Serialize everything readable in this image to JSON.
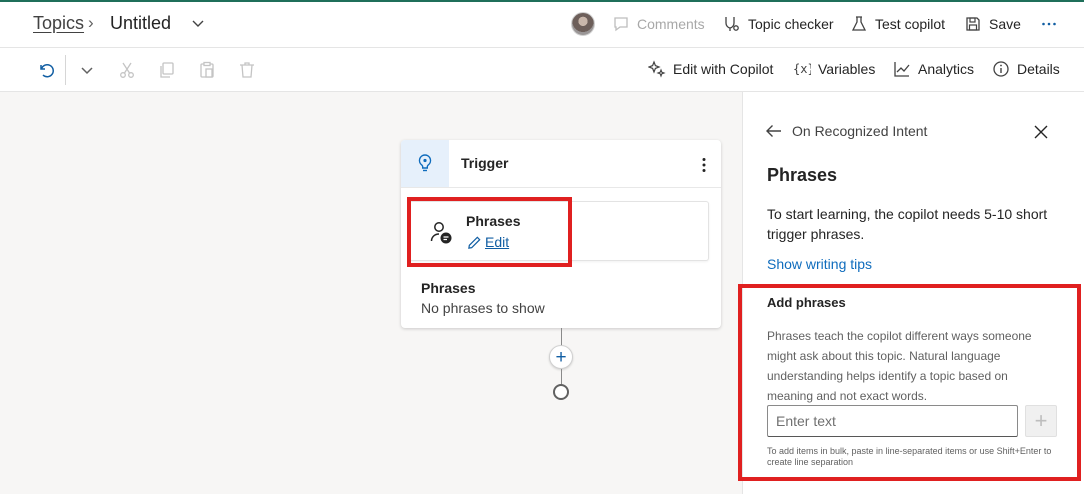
{
  "header": {
    "breadcrumb_root": "Topics",
    "breadcrumb_separator": "›",
    "topic_title": "Untitled",
    "comments_label": "Comments",
    "topic_checker_label": "Topic checker",
    "test_label": "Test copilot",
    "save_label": "Save"
  },
  "command_bar": {
    "edit_with_copilot": "Edit with Copilot",
    "variables": "Variables",
    "analytics": "Analytics",
    "details": "Details"
  },
  "canvas": {
    "trigger": {
      "title": "Trigger",
      "phrases_node_title": "Phrases",
      "edit_link": "Edit",
      "phrases_label": "Phrases",
      "phrases_empty": "No phrases to show"
    }
  },
  "panel": {
    "back_label": "On Recognized Intent",
    "title": "Phrases",
    "description": "To start learning, the copilot needs 5-10 short trigger phrases.",
    "tips_link": "Show writing tips",
    "add_title": "Add phrases",
    "add_description": "Phrases teach the copilot different ways someone might ask about this topic. Natural language understanding helps identify a topic based on meaning and not exact words.",
    "input_placeholder": "Enter text",
    "input_value": "",
    "bulk_note": "To add items in bulk, paste in line-separated items or use Shift+Enter to create line separation"
  },
  "colors": {
    "accent": "#0f6cbd",
    "highlight_box": "#e02020",
    "trigger_icon_bg": "#e6f0fb"
  },
  "icons": [
    "chevron-down-icon",
    "avatar",
    "comment-icon",
    "topic-checker-icon",
    "beaker-icon",
    "save-icon",
    "more-icon",
    "undo-icon",
    "chevron-down-icon",
    "cut-icon",
    "copy-icon",
    "paste-icon",
    "delete-icon",
    "copilot-sparkle-icon",
    "variables-icon",
    "analytics-icon",
    "info-icon",
    "lightbulb-icon",
    "person-chat-icon",
    "pencil-icon",
    "arrow-left-icon",
    "close-icon",
    "plus-icon"
  ]
}
